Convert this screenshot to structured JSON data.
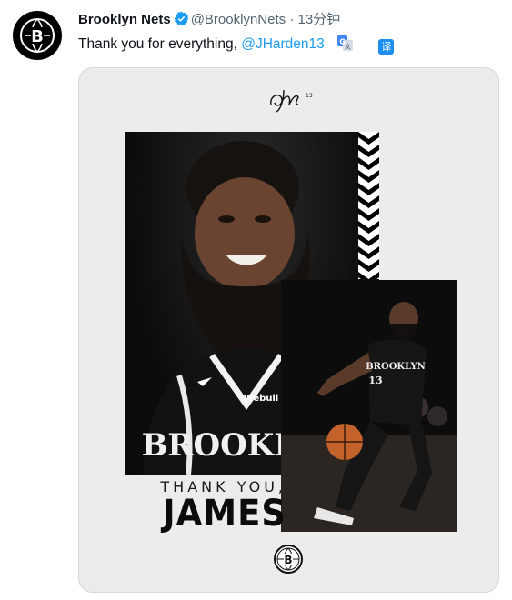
{
  "tweet": {
    "display_name": "Brooklyn Nets",
    "handle": "@BrooklynNets",
    "separator": "·",
    "time": "13分钟",
    "text_prefix": "Thank you for everything, ",
    "mention": "@JHarden13",
    "translate_label": "译"
  },
  "media": {
    "thank_you": "THANK YOU,",
    "name": "JAMES",
    "jersey_text": "BROOKLYN",
    "jersey_text_small": "BROOKLYN",
    "sponsor_patch": "Webull",
    "jersey_number": "13"
  },
  "colors": {
    "link": "#1d9bf0",
    "verified": "#1d9bf0",
    "translate_button": "#1d8ef0",
    "brand": "#000000"
  },
  "icons": [
    "nets-logo-icon",
    "verified-badge-icon",
    "google-translate-icon",
    "signature-icon"
  ]
}
